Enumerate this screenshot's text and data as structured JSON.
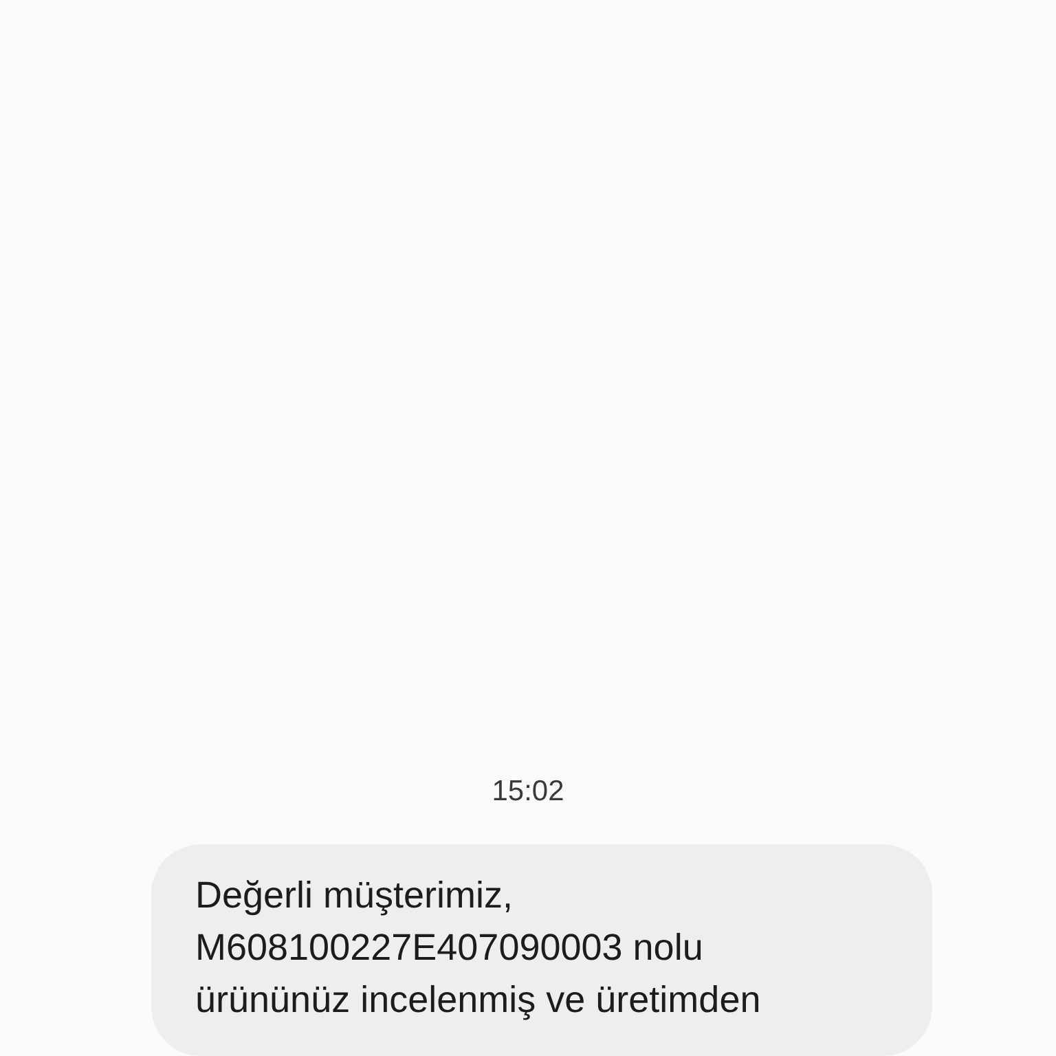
{
  "conversation": {
    "timestamp": "15:02",
    "messages": [
      {
        "text": "Değerli müşterimiz,\nM608100227E407090003 nolu\nürününüz incelenmiş ve üretimden"
      }
    ]
  }
}
